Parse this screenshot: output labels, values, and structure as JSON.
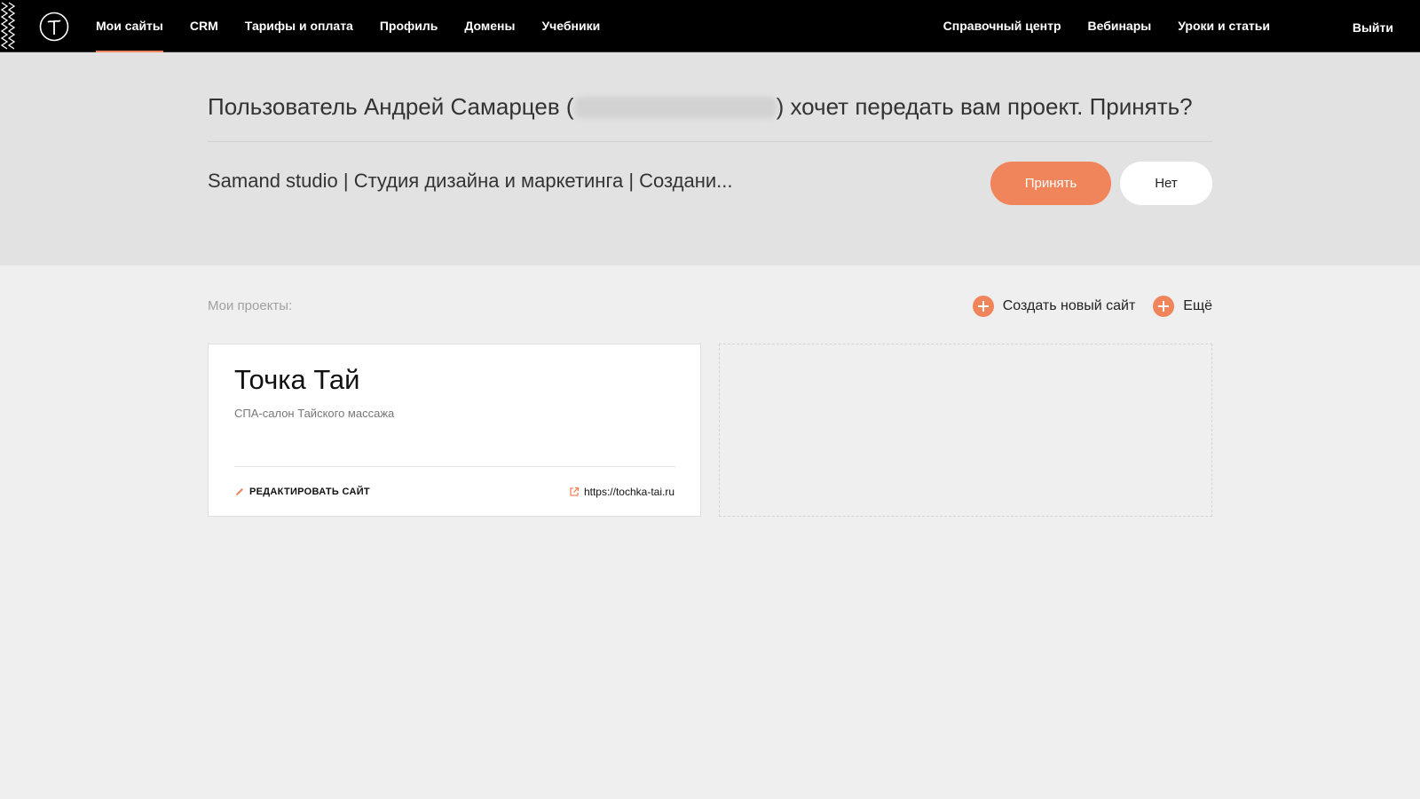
{
  "nav": {
    "logo": "tilda-logo-icon",
    "left": [
      {
        "label": "Мои сайты",
        "active": true
      },
      {
        "label": "CRM"
      },
      {
        "label": "Тарифы и оплата"
      },
      {
        "label": "Профиль"
      },
      {
        "label": "Домены"
      },
      {
        "label": "Учебники"
      }
    ],
    "right": [
      {
        "label": "Справочный центр"
      },
      {
        "label": "Вебинары"
      },
      {
        "label": "Уроки и статьи"
      }
    ],
    "logout": "Выйти"
  },
  "transfer": {
    "title_prefix": "Пользователь Андрей Самарцев (",
    "title_suffix": ") хочет передать вам проект. Принять?",
    "project_name": "Samand studio | Студия дизайна и маркетинга | Создани...",
    "accept_label": "Принять",
    "decline_label": "Нет"
  },
  "projects": {
    "label": "Мои проекты:",
    "create_label": "Создать новый сайт",
    "more_label": "Ещё",
    "items": [
      {
        "title": "Точка Тай",
        "description": "СПА-салон Тайского массажа",
        "edit_label": "РЕДАКТИРОВАТЬ САЙТ",
        "url": "https://tochka-tai.ru"
      }
    ]
  },
  "colors": {
    "accent": "#f0845a",
    "nav_bg": "#000000",
    "panel_bg": "#e2e2e2",
    "page_bg": "#efefef"
  }
}
